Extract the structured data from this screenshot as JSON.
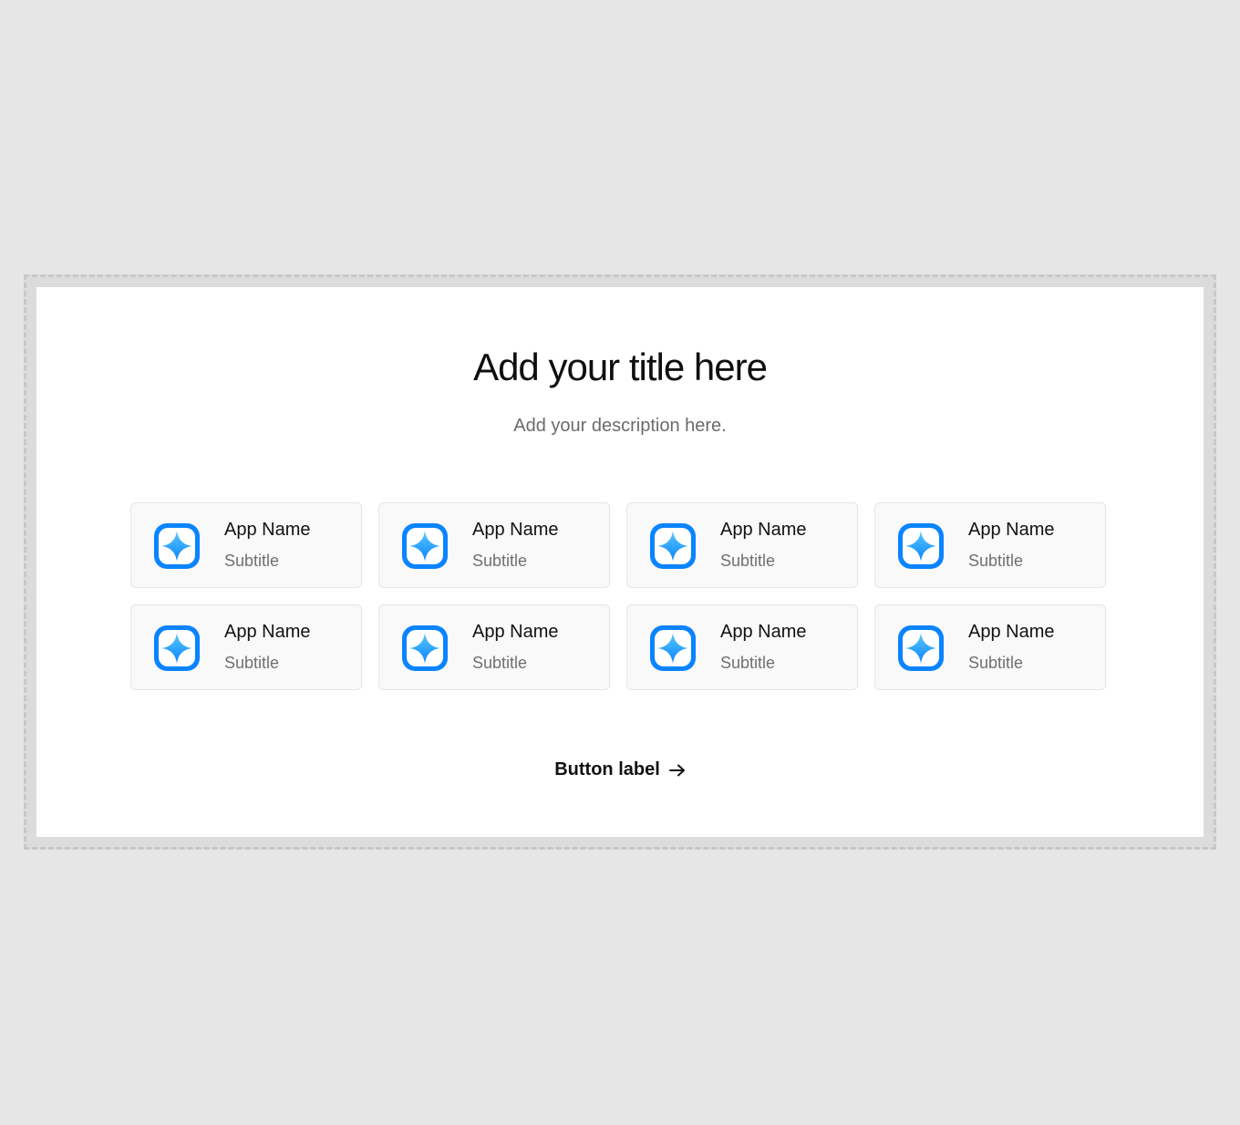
{
  "hero": {
    "title": "Add your title here",
    "description": "Add your description here."
  },
  "apps": [
    {
      "name": "App Name",
      "subtitle": "Subtitle",
      "icon": "sparkle-app-icon"
    },
    {
      "name": "App Name",
      "subtitle": "Subtitle",
      "icon": "sparkle-app-icon"
    },
    {
      "name": "App Name",
      "subtitle": "Subtitle",
      "icon": "sparkle-app-icon"
    },
    {
      "name": "App Name",
      "subtitle": "Subtitle",
      "icon": "sparkle-app-icon"
    },
    {
      "name": "App Name",
      "subtitle": "Subtitle",
      "icon": "sparkle-app-icon"
    },
    {
      "name": "App Name",
      "subtitle": "Subtitle",
      "icon": "sparkle-app-icon"
    },
    {
      "name": "App Name",
      "subtitle": "Subtitle",
      "icon": "sparkle-app-icon"
    },
    {
      "name": "App Name",
      "subtitle": "Subtitle",
      "icon": "sparkle-app-icon"
    }
  ],
  "cta": {
    "label": "Button label",
    "icon": "arrow-right-icon"
  },
  "colors": {
    "page_background": "#e6e6e6",
    "panel_background": "#ffffff",
    "card_background": "#f9f9f9",
    "icon_blue": "#0a84ff",
    "icon_light_blue": "#5ac8fa",
    "text_primary": "#111111",
    "text_secondary": "#707070"
  }
}
